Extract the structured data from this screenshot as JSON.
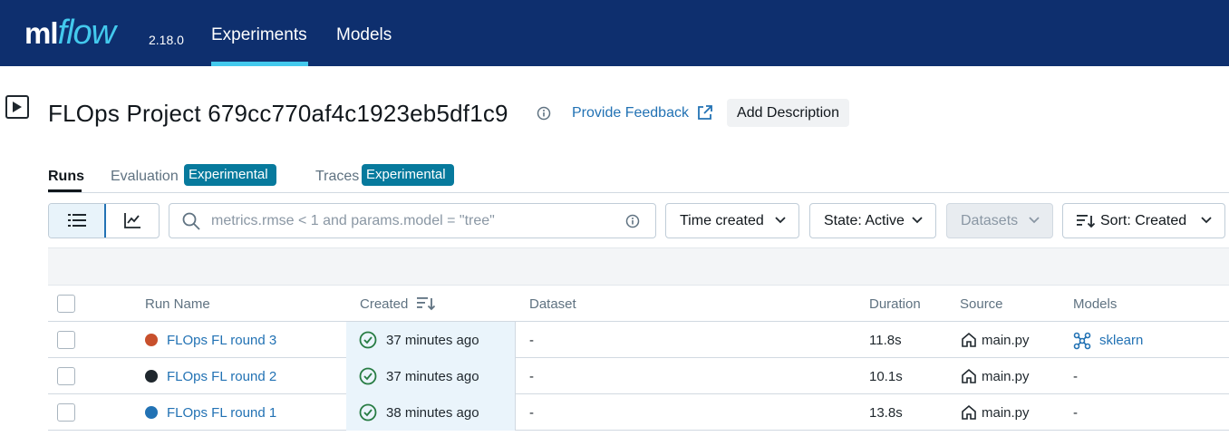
{
  "app": {
    "logo_ml": "ml",
    "logo_flow": "flow",
    "version": "2.18.0",
    "nav": [
      {
        "label": "Experiments",
        "active": true
      },
      {
        "label": "Models",
        "active": false
      }
    ],
    "accent_color": "#43c9ed",
    "nav_bg_color": "#0e2f6e"
  },
  "header": {
    "title": "FLOps Project 679cc770af4c1923eb5df1c9",
    "feedback_label": "Provide Feedback",
    "add_description_label": "Add Description"
  },
  "tabs": [
    {
      "label": "Runs",
      "active": true
    },
    {
      "label": "Evaluation",
      "tag": "Experimental"
    },
    {
      "label": "Traces",
      "tag": "Experimental"
    }
  ],
  "toolbar": {
    "search_placeholder": "metrics.rmse < 1 and params.model = \"tree\"",
    "time_filter_label": "Time created",
    "state_filter_label": "State: Active",
    "datasets_label": "Datasets",
    "sort_label": "Sort: Created"
  },
  "table": {
    "columns": [
      "Run Name",
      "Created",
      "Dataset",
      "Duration",
      "Source",
      "Models"
    ],
    "rows": [
      {
        "run_name": "FLOps FL round 3",
        "color": "#c8502c",
        "created": "37 minutes ago",
        "dataset": "-",
        "duration": "11.8s",
        "source": "main.py",
        "models": "sklearn",
        "has_model": true
      },
      {
        "run_name": "FLOps FL round 2",
        "color": "#1f272d",
        "created": "37 minutes ago",
        "dataset": "-",
        "duration": "10.1s",
        "source": "main.py",
        "models": "-",
        "has_model": false
      },
      {
        "run_name": "FLOps FL round 1",
        "color": "#2272b4",
        "created": "38 minutes ago",
        "dataset": "-",
        "duration": "13.8s",
        "source": "main.py",
        "models": "-",
        "has_model": false
      }
    ]
  }
}
